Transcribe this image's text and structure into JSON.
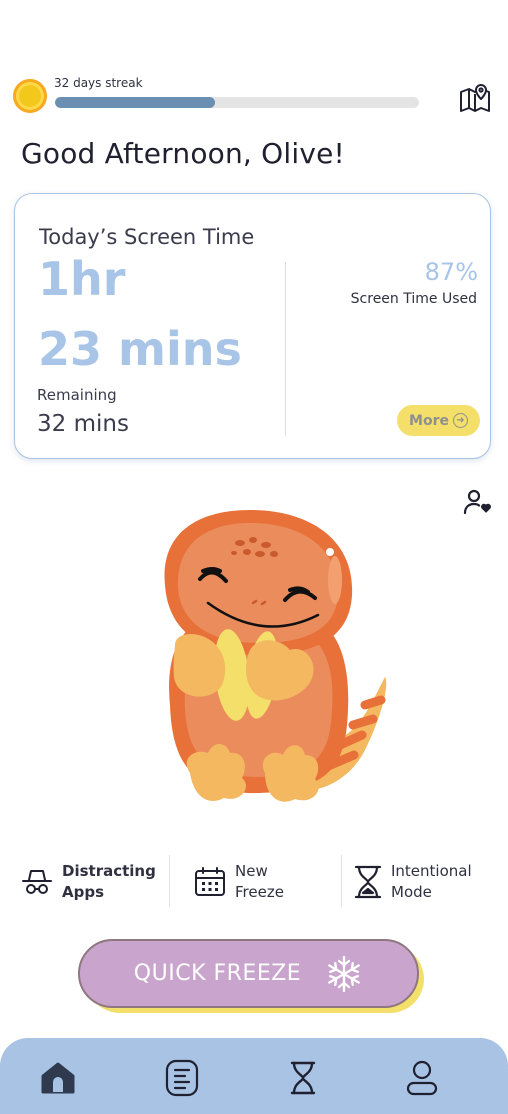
{
  "streak": {
    "label": "32 days streak",
    "progress": 0.44
  },
  "greeting": "Good Afternoon, Olive!",
  "screen_time": {
    "title": "Today’s Screen Time",
    "hours": "1hr",
    "minutes": "23 mins",
    "remaining_label": "Remaining",
    "remaining_value": "32 mins",
    "percent": "87%",
    "percent_label": "Screen Time Used",
    "more_label": "More"
  },
  "shortcuts": [
    {
      "line1": "Distracting",
      "line2": "Apps",
      "icon": "spy-icon"
    },
    {
      "line1": "New",
      "line2": "Freeze",
      "icon": "calendar-icon"
    },
    {
      "line1": "Intentional",
      "line2": "Mode",
      "icon": "hourglass-icon"
    }
  ],
  "quick_freeze": {
    "label": "QUICK FREEZE",
    "icon": "snowflake-icon"
  },
  "tabs": [
    {
      "icon": "home-icon"
    },
    {
      "icon": "list-icon"
    },
    {
      "icon": "hourglass-icon"
    },
    {
      "icon": "profile-icon"
    }
  ],
  "colors": {
    "accent_blue": "#a8c4e6",
    "streak_fill": "#6a8fb3",
    "yellow": "#f3df6a",
    "freeze_purple": "#c9a4cc",
    "mascot_orange": "#e8713a"
  }
}
